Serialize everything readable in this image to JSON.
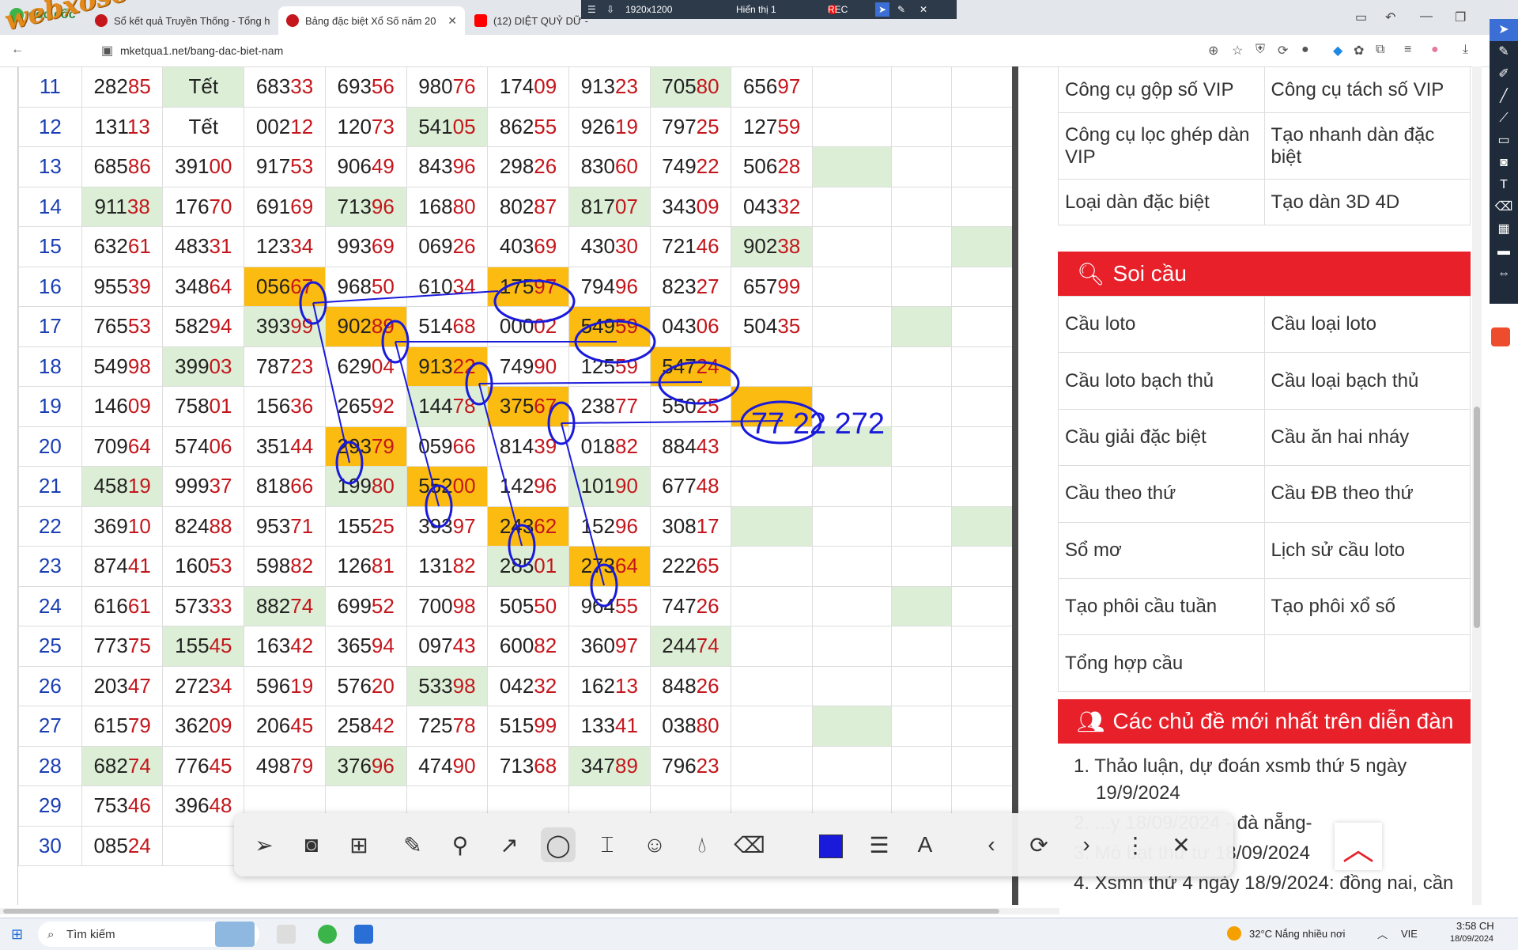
{
  "browser": {
    "brand": "cốc cốc",
    "tabs": [
      {
        "label": "Sổ kết quả Truyền Thống - Tổng h"
      },
      {
        "label": "Bảng đặc biệt Xổ Số năm 20"
      },
      {
        "label": "(12) DIỆT QUỶ DỮ -"
      }
    ],
    "url": "mketqua1.net/bang-dac-biet-nam"
  },
  "recorder": {
    "resolution": "1920x1200",
    "display": "Hiển thị 1",
    "rec": "REC"
  },
  "watermark": "webxoso.net",
  "table": {
    "rows": [
      {
        "day": "11",
        "cells": [
          {
            "a": "282",
            "b": "85"
          },
          {
            "a": "",
            "b": "Tết",
            "c": "g",
            "full": true
          },
          {
            "a": "683",
            "b": "33"
          },
          {
            "a": "693",
            "b": "56"
          },
          {
            "a": "980",
            "b": "76"
          },
          {
            "a": "174",
            "b": "09"
          },
          {
            "a": "913",
            "b": "23"
          },
          {
            "a": "705",
            "b": "80",
            "c": "g"
          },
          {
            "a": "656",
            "b": "97"
          },
          {
            "a": "",
            "b": ""
          }
        ],
        "extra": [
          "",
          ""
        ]
      },
      {
        "day": "12",
        "cells": [
          {
            "a": "131",
            "b": "13"
          },
          {
            "a": "",
            "b": "Tết",
            "full": true
          },
          {
            "a": "002",
            "b": "12"
          },
          {
            "a": "120",
            "b": "73"
          },
          {
            "a": "541",
            "b": "05",
            "c": "g"
          },
          {
            "a": "862",
            "b": "55"
          },
          {
            "a": "926",
            "b": "19"
          },
          {
            "a": "797",
            "b": "25"
          },
          {
            "a": "127",
            "b": "59"
          },
          {
            "a": "",
            "b": ""
          }
        ],
        "extra": [
          "",
          ""
        ]
      },
      {
        "day": "13",
        "cells": [
          {
            "a": "685",
            "b": "86"
          },
          {
            "a": "391",
            "b": "00"
          },
          {
            "a": "917",
            "b": "53"
          },
          {
            "a": "906",
            "b": "49"
          },
          {
            "a": "843",
            "b": "96"
          },
          {
            "a": "298",
            "b": "26"
          },
          {
            "a": "830",
            "b": "60"
          },
          {
            "a": "749",
            "b": "22"
          },
          {
            "a": "506",
            "b": "28"
          },
          {
            "a": "",
            "b": "",
            "c": "g"
          }
        ],
        "extra": [
          "",
          ""
        ]
      },
      {
        "day": "14",
        "cells": [
          {
            "a": "911",
            "b": "38",
            "c": "g"
          },
          {
            "a": "176",
            "b": "70"
          },
          {
            "a": "691",
            "b": "69"
          },
          {
            "a": "713",
            "b": "96",
            "c": "g"
          },
          {
            "a": "168",
            "b": "80"
          },
          {
            "a": "802",
            "b": "87"
          },
          {
            "a": "817",
            "b": "07",
            "c": "g"
          },
          {
            "a": "343",
            "b": "09"
          },
          {
            "a": "043",
            "b": "32"
          },
          {
            "a": "",
            "b": ""
          }
        ],
        "extra": [
          "",
          ""
        ]
      },
      {
        "day": "15",
        "cells": [
          {
            "a": "632",
            "b": "61"
          },
          {
            "a": "483",
            "b": "31"
          },
          {
            "a": "123",
            "b": "34"
          },
          {
            "a": "993",
            "b": "69"
          },
          {
            "a": "069",
            "b": "26"
          },
          {
            "a": "403",
            "b": "69"
          },
          {
            "a": "430",
            "b": "30"
          },
          {
            "a": "721",
            "b": "46"
          },
          {
            "a": "902",
            "b": "38",
            "c": "g"
          },
          {
            "a": "",
            "b": ""
          }
        ],
        "extra": [
          "",
          "g"
        ]
      },
      {
        "day": "16",
        "cells": [
          {
            "a": "955",
            "b": "39"
          },
          {
            "a": "348",
            "b": "64"
          },
          {
            "a": "056",
            "b": "67",
            "c": "o"
          },
          {
            "a": "968",
            "b": "50"
          },
          {
            "a": "610",
            "b": "34"
          },
          {
            "a": "175",
            "b": "97",
            "c": "o"
          },
          {
            "a": "794",
            "b": "96"
          },
          {
            "a": "823",
            "b": "27"
          },
          {
            "a": "657",
            "b": "99"
          },
          {
            "a": "",
            "b": ""
          }
        ],
        "extra": [
          "",
          ""
        ]
      },
      {
        "day": "17",
        "cells": [
          {
            "a": "765",
            "b": "53"
          },
          {
            "a": "582",
            "b": "94"
          },
          {
            "a": "393",
            "b": "99",
            "c": "g"
          },
          {
            "a": "902",
            "b": "89",
            "c": "o"
          },
          {
            "a": "514",
            "b": "68"
          },
          {
            "a": "000",
            "b": "02"
          },
          {
            "a": "549",
            "b": "59",
            "c": "o"
          },
          {
            "a": "043",
            "b": "06"
          },
          {
            "a": "504",
            "b": "35"
          },
          {
            "a": "",
            "b": ""
          }
        ],
        "extra": [
          "g",
          ""
        ]
      },
      {
        "day": "18",
        "cells": [
          {
            "a": "549",
            "b": "98"
          },
          {
            "a": "399",
            "b": "03",
            "c": "g"
          },
          {
            "a": "787",
            "b": "23"
          },
          {
            "a": "629",
            "b": "04"
          },
          {
            "a": "913",
            "b": "22",
            "c": "o"
          },
          {
            "a": "749",
            "b": "90"
          },
          {
            "a": "125",
            "b": "59"
          },
          {
            "a": "547",
            "b": "24",
            "c": "o"
          },
          {
            "a": "",
            "b": ""
          },
          {
            "a": "",
            "b": ""
          }
        ],
        "extra": [
          "",
          ""
        ]
      },
      {
        "day": "19",
        "cells": [
          {
            "a": "146",
            "b": "09"
          },
          {
            "a": "758",
            "b": "01"
          },
          {
            "a": "156",
            "b": "36"
          },
          {
            "a": "265",
            "b": "92"
          },
          {
            "a": "144",
            "b": "78",
            "c": "g"
          },
          {
            "a": "375",
            "b": "67",
            "c": "o"
          },
          {
            "a": "238",
            "b": "77"
          },
          {
            "a": "550",
            "b": "25"
          },
          {
            "a": "",
            "b": "",
            "c": "o"
          },
          {
            "a": "",
            "b": ""
          }
        ],
        "extra": [
          "",
          ""
        ]
      },
      {
        "day": "20",
        "cells": [
          {
            "a": "709",
            "b": "64"
          },
          {
            "a": "574",
            "b": "06"
          },
          {
            "a": "351",
            "b": "44"
          },
          {
            "a": "293",
            "b": "79",
            "c": "o"
          },
          {
            "a": "059",
            "b": "66"
          },
          {
            "a": "814",
            "b": "39"
          },
          {
            "a": "018",
            "b": "82"
          },
          {
            "a": "884",
            "b": "43"
          },
          {
            "a": "",
            "b": ""
          },
          {
            "a": "",
            "b": "",
            "c": "g"
          }
        ],
        "extra": [
          "",
          ""
        ]
      },
      {
        "day": "21",
        "cells": [
          {
            "a": "458",
            "b": "19",
            "c": "g"
          },
          {
            "a": "999",
            "b": "37"
          },
          {
            "a": "818",
            "b": "66"
          },
          {
            "a": "199",
            "b": "80",
            "c": "g"
          },
          {
            "a": "552",
            "b": "00",
            "c": "o"
          },
          {
            "a": "142",
            "b": "96"
          },
          {
            "a": "101",
            "b": "90",
            "c": "g"
          },
          {
            "a": "677",
            "b": "48"
          },
          {
            "a": "",
            "b": ""
          },
          {
            "a": "",
            "b": ""
          }
        ],
        "extra": [
          "",
          ""
        ]
      },
      {
        "day": "22",
        "cells": [
          {
            "a": "369",
            "b": "10"
          },
          {
            "a": "824",
            "b": "88"
          },
          {
            "a": "953",
            "b": "71"
          },
          {
            "a": "155",
            "b": "25"
          },
          {
            "a": "393",
            "b": "97"
          },
          {
            "a": "243",
            "b": "62",
            "c": "o"
          },
          {
            "a": "152",
            "b": "96"
          },
          {
            "a": "308",
            "b": "17"
          },
          {
            "a": "",
            "b": "",
            "c": "g"
          },
          {
            "a": "",
            "b": ""
          }
        ],
        "extra": [
          "",
          "g"
        ]
      },
      {
        "day": "23",
        "cells": [
          {
            "a": "874",
            "b": "41"
          },
          {
            "a": "160",
            "b": "53"
          },
          {
            "a": "598",
            "b": "82"
          },
          {
            "a": "126",
            "b": "81"
          },
          {
            "a": "131",
            "b": "82"
          },
          {
            "a": "285",
            "b": "01",
            "c": "g"
          },
          {
            "a": "273",
            "b": "64",
            "c": "o"
          },
          {
            "a": "222",
            "b": "65"
          },
          {
            "a": "",
            "b": ""
          },
          {
            "a": "",
            "b": ""
          }
        ],
        "extra": [
          "",
          ""
        ]
      },
      {
        "day": "24",
        "cells": [
          {
            "a": "616",
            "b": "61"
          },
          {
            "a": "573",
            "b": "33"
          },
          {
            "a": "882",
            "b": "74",
            "c": "g"
          },
          {
            "a": "699",
            "b": "52"
          },
          {
            "a": "700",
            "b": "98"
          },
          {
            "a": "505",
            "b": "50"
          },
          {
            "a": "964",
            "b": "55"
          },
          {
            "a": "747",
            "b": "26"
          },
          {
            "a": "",
            "b": ""
          },
          {
            "a": "",
            "b": ""
          }
        ],
        "extra": [
          "g",
          ""
        ]
      },
      {
        "day": "25",
        "cells": [
          {
            "a": "773",
            "b": "75"
          },
          {
            "a": "155",
            "b": "45",
            "c": "g"
          },
          {
            "a": "163",
            "b": "42"
          },
          {
            "a": "365",
            "b": "94"
          },
          {
            "a": "097",
            "b": "43"
          },
          {
            "a": "600",
            "b": "82"
          },
          {
            "a": "360",
            "b": "97"
          },
          {
            "a": "244",
            "b": "74",
            "c": "g"
          },
          {
            "a": "",
            "b": ""
          },
          {
            "a": "",
            "b": ""
          }
        ],
        "extra": [
          "",
          ""
        ]
      },
      {
        "day": "26",
        "cells": [
          {
            "a": "203",
            "b": "47"
          },
          {
            "a": "272",
            "b": "34"
          },
          {
            "a": "596",
            "b": "19"
          },
          {
            "a": "576",
            "b": "20"
          },
          {
            "a": "533",
            "b": "98",
            "c": "g"
          },
          {
            "a": "042",
            "b": "32"
          },
          {
            "a": "162",
            "b": "13"
          },
          {
            "a": "848",
            "b": "26"
          },
          {
            "a": "",
            "b": ""
          },
          {
            "a": "",
            "b": ""
          }
        ],
        "extra": [
          "",
          ""
        ]
      },
      {
        "day": "27",
        "cells": [
          {
            "a": "615",
            "b": "79"
          },
          {
            "a": "362",
            "b": "09"
          },
          {
            "a": "206",
            "b": "45"
          },
          {
            "a": "258",
            "b": "42"
          },
          {
            "a": "725",
            "b": "78"
          },
          {
            "a": "515",
            "b": "99"
          },
          {
            "a": "133",
            "b": "41"
          },
          {
            "a": "038",
            "b": "80"
          },
          {
            "a": "",
            "b": ""
          },
          {
            "a": "",
            "b": "",
            "c": "g"
          }
        ],
        "extra": [
          "",
          ""
        ]
      },
      {
        "day": "28",
        "cells": [
          {
            "a": "682",
            "b": "74",
            "c": "g"
          },
          {
            "a": "776",
            "b": "45"
          },
          {
            "a": "498",
            "b": "79"
          },
          {
            "a": "376",
            "b": "96",
            "c": "g"
          },
          {
            "a": "474",
            "b": "90"
          },
          {
            "a": "713",
            "b": "68"
          },
          {
            "a": "347",
            "b": "89",
            "c": "g"
          },
          {
            "a": "796",
            "b": "23"
          },
          {
            "a": "",
            "b": ""
          },
          {
            "a": "",
            "b": ""
          }
        ],
        "extra": [
          "",
          ""
        ]
      },
      {
        "day": "29",
        "cells": [
          {
            "a": "753",
            "b": "46"
          },
          {
            "a": "396",
            "b": "48"
          },
          {
            "a": "",
            "b": ""
          },
          {
            "a": "",
            "b": ""
          },
          {
            "a": "",
            "b": ""
          },
          {
            "a": "",
            "b": ""
          },
          {
            "a": "",
            "b": ""
          },
          {
            "a": "",
            "b": ""
          },
          {
            "a": "",
            "b": ""
          },
          {
            "a": "",
            "b": ""
          }
        ],
        "extra": [
          "",
          ""
        ]
      },
      {
        "day": "30",
        "cells": [
          {
            "a": "085",
            "b": "24"
          },
          {
            "a": "",
            "b": ""
          },
          {
            "a": "",
            "b": ""
          },
          {
            "a": "",
            "b": ""
          },
          {
            "a": "",
            "b": ""
          },
          {
            "a": "",
            "b": ""
          },
          {
            "a": "",
            "b": ""
          },
          {
            "a": "",
            "b": ""
          },
          {
            "a": "",
            "b": ""
          },
          {
            "a": "",
            "b": ""
          }
        ],
        "extra": [
          "",
          ""
        ]
      }
    ]
  },
  "annotation_text": "77 22 272",
  "sidebar": {
    "tools": [
      [
        "Công cụ gộp số VIP",
        "Công cụ tách số VIP"
      ],
      [
        "Công cụ lọc ghép dàn VIP",
        "Tạo nhanh dàn đặc biệt"
      ],
      [
        "Loại dàn đặc biệt",
        "Tạo dàn 3D 4D"
      ]
    ],
    "soi_cau_title": "Soi cầu",
    "soi_cau": [
      [
        "Cầu loto",
        "Cầu loại loto"
      ],
      [
        "Cầu loto bạch thủ",
        "Cầu loại bạch thủ"
      ],
      [
        "Cầu giải đặc biệt",
        "Cầu ăn hai nháy"
      ],
      [
        "Cầu theo thứ",
        "Cầu ĐB theo thứ"
      ],
      [
        "Sổ mơ",
        "Lịch sử cầu loto"
      ],
      [
        "Tạo phôi cầu tuần",
        "Tạo phôi xổ số"
      ],
      [
        "Tổng hợp cầu",
        ""
      ]
    ],
    "forum_title": "Các chủ đề mới nhất trên diễn đàn",
    "forum": [
      "1. Thảo luận, dự đoán xsmb thứ 5 ngày 19/9/2024",
      "2. ...y 18/09/2024 - đà nẵng-",
      "3. Mò bạt thứ tư 18/09/2024",
      "4. Xsmn thứ 4 ngày 18/9/2024: đồng nai, cần"
    ]
  },
  "taskbar": {
    "search": "Tìm kiếm",
    "weather": "32°C  Nắng nhiều nơi",
    "lang": "VIE",
    "time": "3:58 CH",
    "date": "18/09/2024"
  },
  "colors": {
    "accent_red": "#e8202a",
    "highlight_orange": "#fbbb10",
    "highlight_green": "#dcefd6",
    "pen_blue": "#1a1adb"
  }
}
